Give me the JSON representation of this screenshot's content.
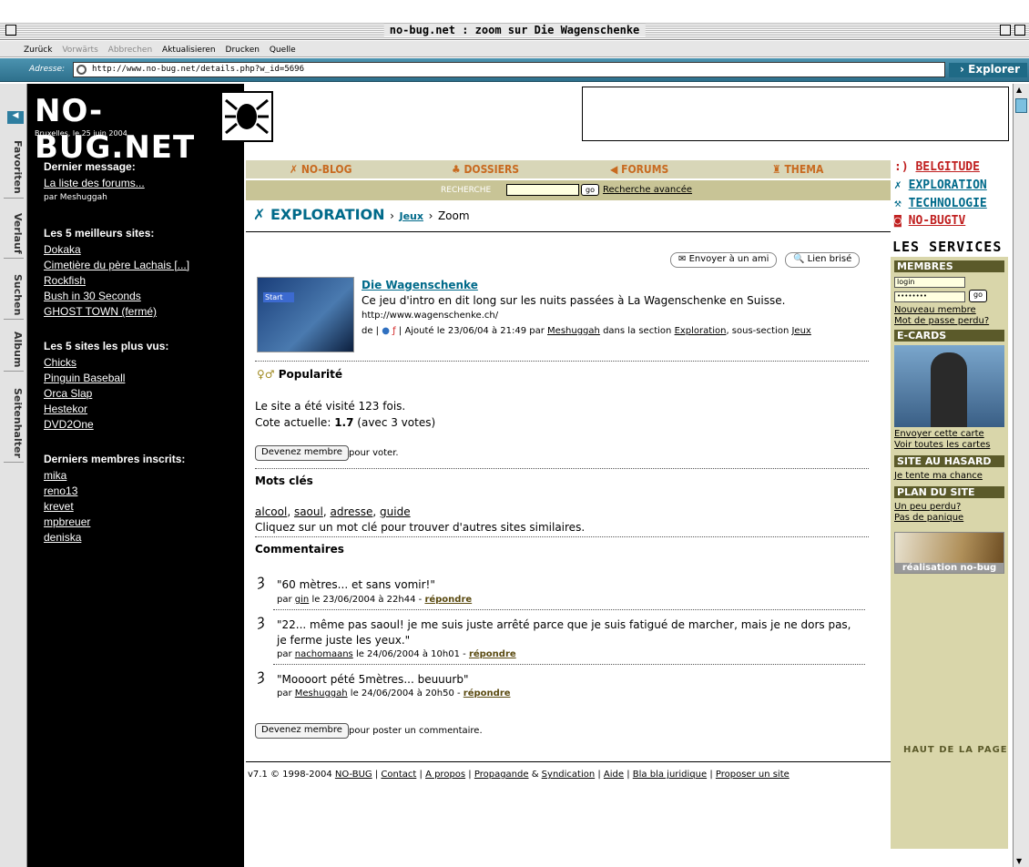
{
  "window": {
    "title": "no-bug.net : zoom sur Die Wagenschenke"
  },
  "toolbar": {
    "back": "Zurück",
    "forward": "Vorwärts",
    "stop": "Abbrechen",
    "refresh": "Aktualisieren",
    "print": "Drucken",
    "source": "Quelle"
  },
  "address": {
    "label": "Adresse:",
    "url": "http://www.no-bug.net/details.php?w_id=5696",
    "go": "Explorer"
  },
  "sidetabs": [
    "Favoriten",
    "Verlauf",
    "Suchen",
    "Album",
    "Seitenhalter"
  ],
  "logo": {
    "text": "NO-BUG.NET",
    "date": "Bruxelles, le 25 juin 2004"
  },
  "left": {
    "last_msg": {
      "title": "Dernier message:",
      "link": "La liste des forums...",
      "by": "par Meshuggah"
    },
    "best": {
      "title": "Les 5 meilleurs sites:",
      "items": [
        "Dokaka",
        "Cimetière du père Lachais [...]",
        "Rockfish",
        "Bush in 30 Seconds",
        "GHOST TOWN (fermé)"
      ]
    },
    "viewed": {
      "title": "Les 5 sites les plus vus:",
      "items": [
        "Chicks",
        "Pinguin Baseball",
        "Orca Slap",
        "Hestekor",
        "DVD2One"
      ]
    },
    "members": {
      "title": "Derniers membres inscrits:",
      "items": [
        "mika",
        "reno13",
        "krevet",
        "mpbreuer",
        "deniska"
      ]
    }
  },
  "nav": {
    "items": [
      "NO-BLOG",
      "DOSSIERS",
      "FORUMS",
      "THEMA"
    ],
    "search_label": "RECHERCHE",
    "search_go": "go",
    "advanced": "Recherche avancée"
  },
  "crumb": {
    "section": "EXPLORATION",
    "sub": "Jeux",
    "current": "Zoom"
  },
  "actions": {
    "send": "Envoyer à un ami",
    "broken": "Lien brisé"
  },
  "site": {
    "name": "Die Wagenschenke",
    "desc": "Ce jeu d'intro en dit long sur les nuits passées à La Wagenschenke en Suisse.",
    "url": "http://www.wagenschenke.ch/",
    "meta_prefix": "de |",
    "meta_added": "| Ajouté le 23/06/04 à 21:49 par",
    "meta_user": "Meshuggah",
    "meta_mid": "dans la section",
    "meta_section": "Exploration",
    "meta_mid2": ", sous-section",
    "meta_sub": "Jeux",
    "thumb_label": "Start"
  },
  "popularity": {
    "title": "Popularité",
    "visits": "Le site a été visité 123 fois.",
    "rating_prefix": "Cote actuelle:",
    "rating": "1.7",
    "rating_suffix": "(avec 3 votes)",
    "btn": "Devenez membre",
    "btn_suffix": "pour voter."
  },
  "keywords": {
    "title": "Mots clés",
    "items": [
      "alcool",
      "saoul",
      "adresse",
      "guide"
    ],
    "hint": "Cliquez sur un mot clé pour trouver d'autres sites similaires."
  },
  "comments": {
    "title": "Commentaires",
    "items": [
      {
        "text": "\"60 mètres... et sans vomir!\"",
        "by": "par",
        "user": "gin",
        "date": "le 23/06/2004 à 22h44 -",
        "reply": "répondre"
      },
      {
        "text": "\"22... même pas saoul! je me suis juste arrêté parce que je suis fatigué de marcher, mais je ne dors pas, je ferme juste les yeux.\"",
        "by": "par",
        "user": "nachomaans",
        "date": "le 24/06/2004 à 10h01 -",
        "reply": "répondre"
      },
      {
        "text": "\"Moooort pété 5mètres... beuuurb\"",
        "by": "par",
        "user": "Meshuggah",
        "date": "le 24/06/2004 à 20h50 -",
        "reply": "répondre"
      }
    ],
    "btn": "Devenez membre",
    "btn_suffix": "pour poster un commentaire."
  },
  "footer": {
    "prefix": "v7.1 © 1998-2004",
    "links": [
      "NO-BUG",
      "Contact",
      "A propos",
      "Propagande",
      "Syndication",
      "Aide",
      "Bla bla juridique",
      "Proposer un site"
    ]
  },
  "right": {
    "sections": [
      "BELGITUDE",
      "EXPLORATION",
      "TECHNOLOGIE",
      "NO-BUGTV"
    ],
    "services": "LES SERVICES",
    "members": {
      "title": "MEMBRES",
      "login": "login",
      "password": "••••••••",
      "go": "go",
      "new": "Nouveau membre",
      "lost": "Mot de passe perdu?"
    },
    "ecards": {
      "title": "E-CARDS",
      "send": "Envoyer cette carte",
      "all": "Voir toutes les cartes"
    },
    "random": {
      "title": "SITE AU HASARD",
      "link": "Je tente ma chance"
    },
    "plan": {
      "title": "PLAN DU SITE",
      "l1": "Un peu perdu?",
      "l2": "Pas de panique"
    },
    "credit": "réalisation no-bug",
    "top": "HAUT DE LA PAGE"
  },
  "colors": {
    "accent": "#006a8a",
    "nav_bg": "#d8d6b8",
    "side_bg": "#d9d6aa",
    "belgitude": "#c02020"
  }
}
